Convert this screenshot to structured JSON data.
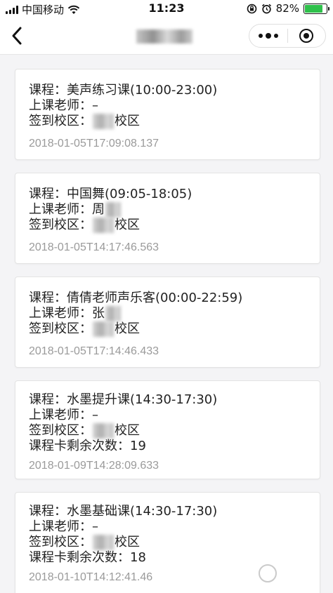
{
  "status_bar": {
    "carrier": "中国移动",
    "time": "11:23",
    "battery_percent": "82%",
    "battery_level": 0.82,
    "battery_color": "#2fc14b"
  },
  "nav": {
    "back_icon": "chevron-left-icon",
    "more_icon": "more-dots-icon",
    "close_icon": "record-close-icon"
  },
  "records": [
    {
      "course_line": "课程：美声练习课(10:00-23:00)",
      "teacher_label": "上课老师：",
      "teacher_value": "–",
      "campus_label": "签到校区：",
      "campus_suffix": "校区",
      "remaining": "",
      "timestamp": "2018-01-05T17:09:08.137"
    },
    {
      "course_line": "课程：中国舞(09:05-18:05)",
      "teacher_label": "上课老师：",
      "teacher_value": "周",
      "campus_label": "签到校区：",
      "campus_suffix": "校区",
      "remaining": "",
      "timestamp": "2018-01-05T14:17:46.563"
    },
    {
      "course_line": "课程：倩倩老师声乐客(00:00-22:59)",
      "teacher_label": "上课老师：",
      "teacher_value": "张",
      "campus_label": "签到校区：",
      "campus_suffix": "校区",
      "remaining": "",
      "timestamp": "2018-01-05T17:14:46.433"
    },
    {
      "course_line": "课程：水墨提升课(14:30-17:30)",
      "teacher_label": "上课老师：",
      "teacher_value": "–",
      "campus_label": "签到校区：",
      "campus_suffix": "校区",
      "remaining": "课程卡剩余次数：19",
      "timestamp": "2018-01-09T14:28:09.633"
    },
    {
      "course_line": "课程：水墨基础课(14:30-17:30)",
      "teacher_label": "上课老师：",
      "teacher_value": "–",
      "campus_label": "签到校区：",
      "campus_suffix": "校区",
      "remaining": "课程卡剩余次数：18",
      "timestamp": "2018-01-10T14:12:41.46"
    }
  ]
}
